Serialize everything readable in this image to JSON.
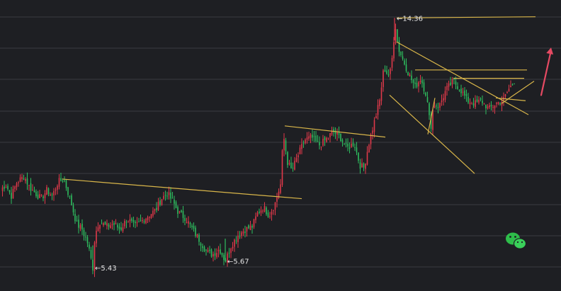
{
  "chart_data": {
    "type": "candlestick",
    "grid": true,
    "colors": {
      "background": "#1e1f23",
      "grid": "#3a3b40",
      "up": "#e0394a",
      "down": "#2ebd5f",
      "trendline": "#d9b64a",
      "arrow": "#e64a63",
      "label": "#e6e6e6"
    },
    "ylim": [
      4.6,
      15.0
    ],
    "points": [
      [
        0,
        8.2
      ],
      [
        8,
        8.4
      ],
      [
        16,
        8.0
      ],
      [
        24,
        8.5
      ],
      [
        34,
        8.7
      ],
      [
        42,
        8.3
      ],
      [
        50,
        8.1
      ],
      [
        58,
        7.9
      ],
      [
        66,
        8.2
      ],
      [
        74,
        8.0
      ],
      [
        82,
        8.5
      ],
      [
        90,
        8.6
      ],
      [
        100,
        7.8
      ],
      [
        108,
        7.0
      ],
      [
        116,
        6.8
      ],
      [
        124,
        6.3
      ],
      [
        128,
        5.8
      ],
      [
        131,
        5.43
      ],
      [
        134,
        6.6
      ],
      [
        140,
        7.1
      ],
      [
        150,
        6.9
      ],
      [
        160,
        7.0
      ],
      [
        170,
        6.8
      ],
      [
        180,
        7.2
      ],
      [
        190,
        6.9
      ],
      [
        200,
        7.1
      ],
      [
        210,
        7.3
      ],
      [
        220,
        7.5
      ],
      [
        228,
        7.9
      ],
      [
        236,
        8.1
      ],
      [
        244,
        7.8
      ],
      [
        252,
        7.4
      ],
      [
        262,
        7.2
      ],
      [
        272,
        6.8
      ],
      [
        282,
        6.4
      ],
      [
        292,
        6.0
      ],
      [
        300,
        5.9
      ],
      [
        310,
        6.1
      ],
      [
        318,
        5.67
      ],
      [
        326,
        6.2
      ],
      [
        336,
        6.6
      ],
      [
        346,
        6.8
      ],
      [
        356,
        6.9
      ],
      [
        364,
        7.4
      ],
      [
        372,
        7.6
      ],
      [
        380,
        7.3
      ],
      [
        388,
        7.7
      ],
      [
        396,
        8.4
      ],
      [
        400,
        10.2
      ],
      [
        406,
        9.2
      ],
      [
        412,
        8.9
      ],
      [
        420,
        9.4
      ],
      [
        430,
        10.0
      ],
      [
        440,
        10.1
      ],
      [
        450,
        9.8
      ],
      [
        460,
        10.0
      ],
      [
        470,
        10.3
      ],
      [
        480,
        10.1
      ],
      [
        490,
        9.7
      ],
      [
        500,
        9.9
      ],
      [
        508,
        9.1
      ],
      [
        514,
        9.0
      ],
      [
        520,
        9.8
      ],
      [
        528,
        10.6
      ],
      [
        536,
        11.4
      ],
      [
        542,
        12.6
      ],
      [
        548,
        12.3
      ],
      [
        552,
        12.5
      ],
      [
        556,
        13.6
      ],
      [
        557,
        14.36
      ],
      [
        562,
        13.3
      ],
      [
        570,
        12.8
      ],
      [
        578,
        12.3
      ],
      [
        586,
        11.9
      ],
      [
        594,
        12.2
      ],
      [
        602,
        11.6
      ],
      [
        608,
        10.4
      ],
      [
        612,
        11.3
      ],
      [
        620,
        11.2
      ],
      [
        630,
        11.8
      ],
      [
        640,
        12.1
      ],
      [
        650,
        11.8
      ],
      [
        660,
        11.4
      ],
      [
        670,
        11.3
      ],
      [
        680,
        11.4
      ],
      [
        690,
        11.1
      ],
      [
        700,
        11.3
      ],
      [
        710,
        11.4
      ],
      [
        718,
        11.8
      ],
      [
        726,
        12.1
      ]
    ],
    "trendlines": [
      {
        "from": [
          88,
          8.6
        ],
        "to": [
          426,
          7.9
        ]
      },
      {
        "from": [
          402,
          10.5
        ],
        "to": [
          544,
          10.1
        ]
      },
      {
        "from": [
          560,
          14.36
        ],
        "to": [
          756,
          14.4
        ]
      },
      {
        "from": [
          560,
          13.5
        ],
        "to": [
          746,
          10.9
        ]
      },
      {
        "from": [
          586,
          12.5
        ],
        "to": [
          744,
          12.5
        ]
      },
      {
        "from": [
          640,
          12.2
        ],
        "to": [
          740,
          12.2
        ]
      },
      {
        "from": [
          700,
          11.5
        ],
        "to": [
          742,
          11.4
        ]
      },
      {
        "from": [
          550,
          11.6
        ],
        "to": [
          670,
          8.8
        ]
      },
      {
        "from": [
          708,
          11.3
        ],
        "to": [
          754,
          12.1
        ]
      },
      {
        "from": [
          604,
          10.2
        ],
        "to": [
          614,
          11.5
        ]
      }
    ],
    "annotations": [
      {
        "text": "14.36",
        "x": 557,
        "y": 14.36
      },
      {
        "text": "5.43",
        "x": 131,
        "y": 5.43
      },
      {
        "text": "5.67",
        "x": 318,
        "y": 5.67
      }
    ],
    "arrow": {
      "from": [
        764,
        11.6
      ],
      "to": [
        778,
        13.3
      ]
    }
  }
}
